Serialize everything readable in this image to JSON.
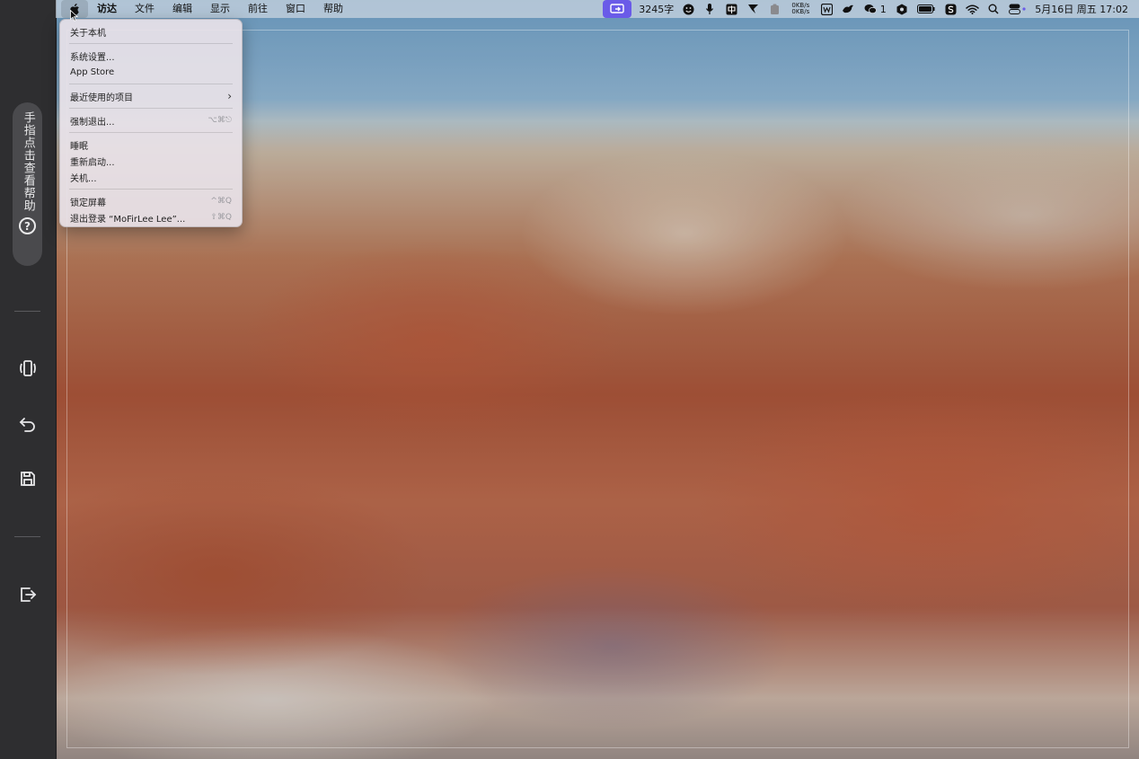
{
  "sidebar": {
    "help_text": "手指点击查看帮助",
    "help_icon": "?",
    "buttons": [
      {
        "name": "rotate-view-icon"
      },
      {
        "name": "undo-icon"
      },
      {
        "name": "save-icon"
      },
      {
        "name": "exit-icon"
      }
    ]
  },
  "menubar": {
    "apple_icon": "apple-logo-icon",
    "app_name": "访达",
    "menus": [
      "文件",
      "编辑",
      "显示",
      "前往",
      "窗口",
      "帮助"
    ],
    "word_count": "3245字",
    "network_up": "0KB/s",
    "network_down": "0KB/s",
    "wechat_count": "1",
    "datetime": "5月16日 周五  17:02",
    "accent_color": "#6a5be8"
  },
  "apple_menu": {
    "items": [
      {
        "label": "关于本机",
        "shortcut": ""
      },
      {
        "label": "系统设置...",
        "shortcut": ""
      },
      {
        "label": "App Store",
        "shortcut": ""
      },
      {
        "label": "最近使用的项目",
        "shortcut": "›"
      },
      {
        "label": "强制退出...",
        "shortcut": "⌥⌘⎋"
      },
      {
        "label": "睡眠",
        "shortcut": ""
      },
      {
        "label": "重新启动...",
        "shortcut": ""
      },
      {
        "label": "关机...",
        "shortcut": ""
      },
      {
        "label": "锁定屏幕",
        "shortcut": "^⌘Q"
      },
      {
        "label": "退出登录 “MoFirLee Lee”...",
        "shortcut": "⇧⌘Q"
      }
    ]
  }
}
